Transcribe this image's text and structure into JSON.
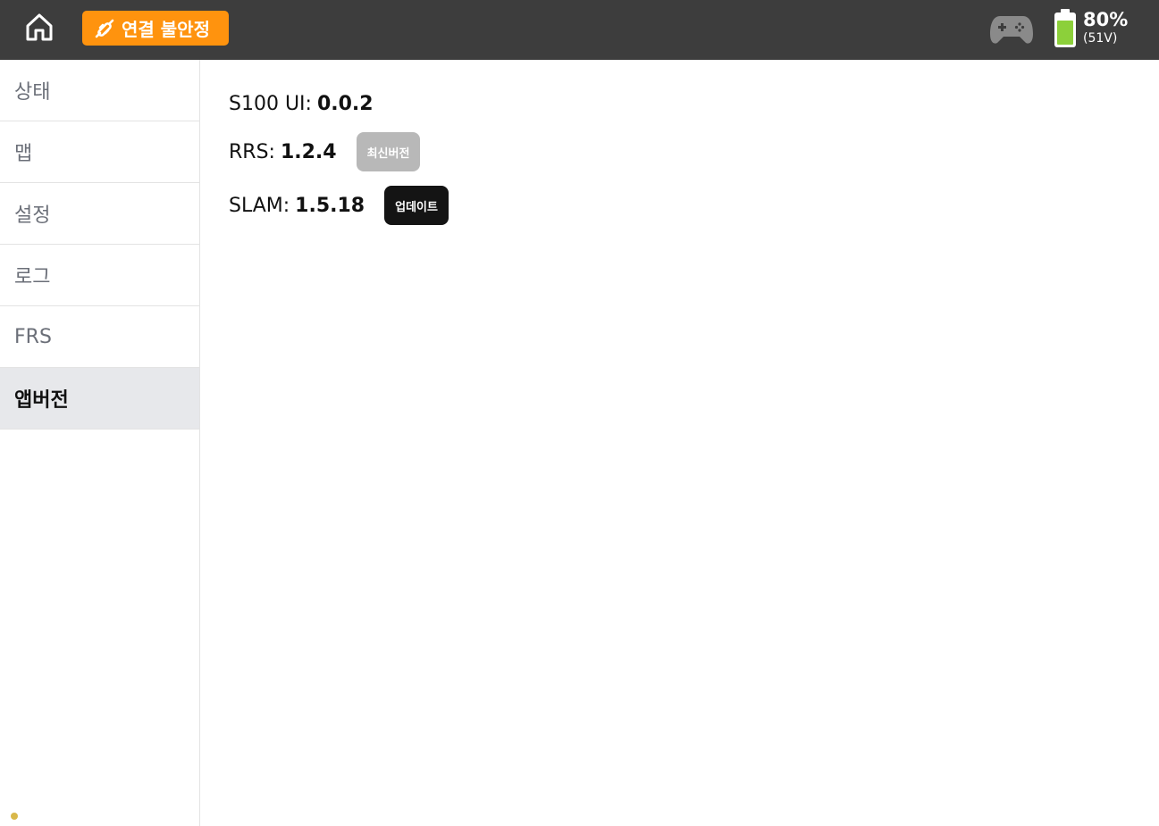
{
  "header": {
    "home_icon": "home-icon",
    "connection": {
      "label": "연결 불안정",
      "icon": "unplugged-icon",
      "color": "#ff930e"
    },
    "gamepad_icon": "gamepad-icon",
    "battery": {
      "icon": "battery-icon",
      "level": 0.8,
      "percent_label": "80%",
      "voltage_label": "(51V)",
      "fill_color": "#8cd03a"
    }
  },
  "sidebar": {
    "items": [
      {
        "label": "상태"
      },
      {
        "label": "맵"
      },
      {
        "label": "설정"
      },
      {
        "label": "로그"
      },
      {
        "label": "FRS"
      },
      {
        "label": "앱버전",
        "active": true
      }
    ]
  },
  "versions": {
    "s100": {
      "label": "S100 UI:",
      "value": "0.0.2"
    },
    "rrs": {
      "label": "RRS:",
      "value": "1.2.4",
      "button": "최신버전"
    },
    "slam": {
      "label": "SLAM:",
      "value": "1.5.18",
      "button": "업데이트"
    }
  }
}
